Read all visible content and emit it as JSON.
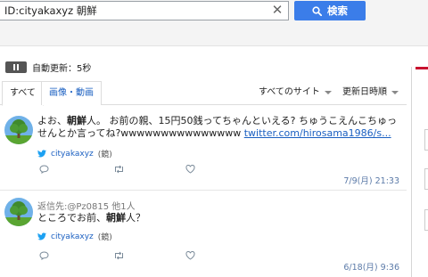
{
  "search": {
    "query": "ID:cityakaxyz 朝鮮",
    "clear_icon": "close-icon",
    "button_label": "検索",
    "button_color": "#3b7de9"
  },
  "auto_update": {
    "label": "自動更新：5秒"
  },
  "tabs": [
    {
      "label": "すべて",
      "selected": true
    },
    {
      "label": "画像・動画",
      "selected": false
    }
  ],
  "filters": {
    "site": "すべてのサイト",
    "sort": "更新日時順"
  },
  "posts": [
    {
      "text_parts": [
        "よお、",
        "朝鮮",
        "人。 お前の親、15円50銭ってちゃんといえる? ちゅうこえんこちゅっせんとか言ってね?wwwwwwwwwwwwwww "
      ],
      "link": "twitter.com/hirosama1986/s...",
      "username": "cityakaxyz",
      "client": "(鏡)",
      "time": "7/9(月) 21:33"
    },
    {
      "reply_to": "返信先:@Pz0815 他1人",
      "text_parts": [
        "ところでお前、",
        "朝鮮",
        "人？"
      ],
      "username": "cityakaxyz",
      "client": "(鏡)",
      "time": "6/18(月) 9:36"
    }
  ],
  "colors": {
    "link": "#1a5fc1",
    "twitter_bird": "#1da1f2"
  }
}
